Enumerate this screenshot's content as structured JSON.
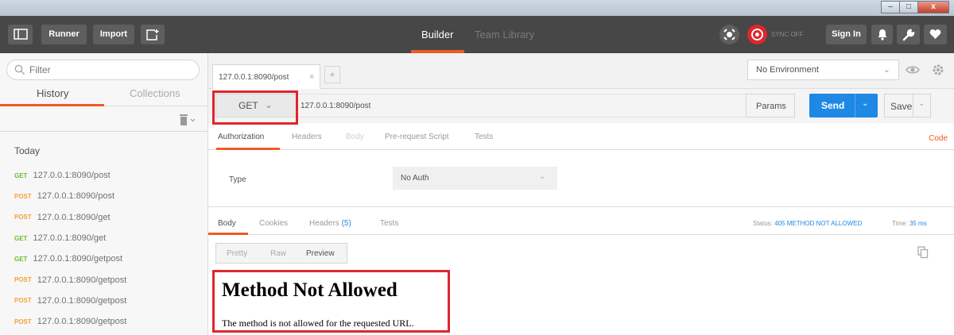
{
  "window": {
    "minimize_label": "–",
    "maximize_label": "□",
    "close_label": "x"
  },
  "appbar": {
    "runner_label": "Runner",
    "import_label": "Import",
    "tabs": [
      {
        "label": "Builder",
        "active": true
      },
      {
        "label": "Team Library",
        "active": false
      }
    ],
    "sync_status": "SYNC OFF",
    "signin_label": "Sign In",
    "accent_color": "#ef5b25"
  },
  "sidebar": {
    "filter_placeholder": "Filter",
    "tabs": [
      {
        "label": "History",
        "active": true
      },
      {
        "label": "Collections",
        "active": false
      }
    ],
    "group_label": "Today",
    "history": [
      {
        "method": "GET",
        "url": "127.0.0.1:8090/post"
      },
      {
        "method": "POST",
        "url": "127.0.0.1:8090/post"
      },
      {
        "method": "POST",
        "url": "127.0.0.1:8090/get"
      },
      {
        "method": "GET",
        "url": "127.0.0.1:8090/get"
      },
      {
        "method": "GET",
        "url": "127.0.0.1:8090/getpost"
      },
      {
        "method": "POST",
        "url": "127.0.0.1:8090/getpost"
      },
      {
        "method": "POST",
        "url": "127.0.0.1:8090/getpost"
      },
      {
        "method": "POST",
        "url": "127.0.0.1:8090/getpost"
      }
    ]
  },
  "request": {
    "tab_title": "127.0.0.1:8090/post",
    "tab_close": "×",
    "tab_add": "+",
    "environment": "No Environment",
    "method": "GET",
    "url": "127.0.0.1:8090/post",
    "params_label": "Params",
    "send_label": "Send",
    "save_label": "Save",
    "subtabs": [
      {
        "label": "Authorization",
        "state": "active"
      },
      {
        "label": "Headers",
        "state": "normal"
      },
      {
        "label": "Body",
        "state": "disabled"
      },
      {
        "label": "Pre-request Script",
        "state": "normal"
      },
      {
        "label": "Tests",
        "state": "normal"
      }
    ],
    "code_label": "Code",
    "auth": {
      "type_label": "Type",
      "type_value": "No Auth"
    }
  },
  "response": {
    "tabs": [
      {
        "label": "Body",
        "active": true
      },
      {
        "label": "Cookies",
        "active": false
      },
      {
        "label": "Headers",
        "active": false,
        "count": "(5)"
      },
      {
        "label": "Tests",
        "active": false
      }
    ],
    "status_label": "Status:",
    "status_value": "405 METHOD NOT ALLOWED",
    "time_label": "Time:",
    "time_value": "35 ms",
    "views": [
      {
        "label": "Pretty",
        "active": false
      },
      {
        "label": "Raw",
        "active": false
      },
      {
        "label": "Preview",
        "active": true
      }
    ],
    "preview_heading": "Method Not Allowed",
    "preview_text": "The method is not allowed for the requested URL."
  }
}
